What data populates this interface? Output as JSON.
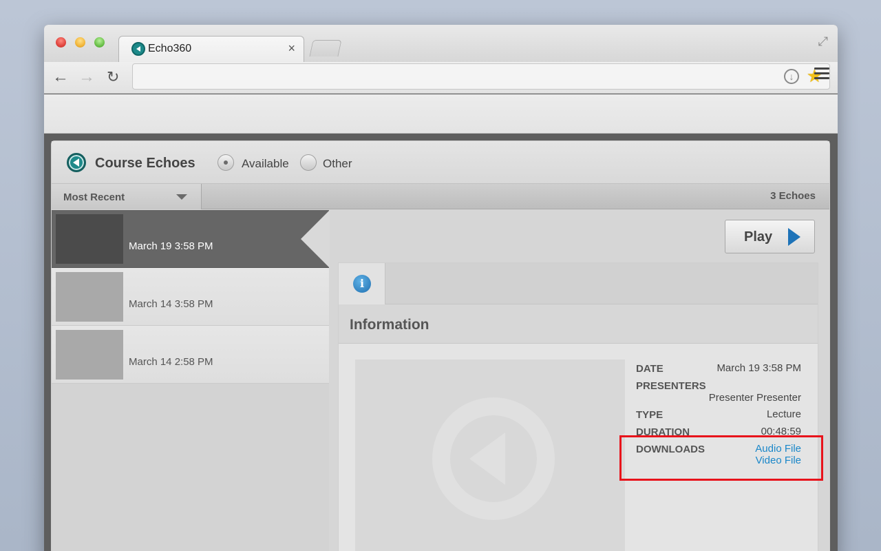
{
  "browser": {
    "tab_title": "Echo360",
    "tab_close": "×",
    "address": "",
    "back_glyph": "←",
    "forward_glyph": "→",
    "reload_glyph": "↻",
    "fullscreen_glyph": "⤢",
    "download_glyph": "↓",
    "star_glyph": "★"
  },
  "app": {
    "title": "Course Echoes",
    "filters": [
      {
        "label": "Available",
        "selected": true
      },
      {
        "label": "Other",
        "selected": false
      }
    ],
    "sort": {
      "selected": "Most Recent"
    },
    "echo_count": "3 Echoes",
    "echoes": [
      {
        "label": "March 19 3:58 PM",
        "selected": true
      },
      {
        "label": "March 14 3:58 PM",
        "selected": false
      },
      {
        "label": "March 14 2:58 PM",
        "selected": false
      }
    ],
    "play_label": "Play"
  },
  "info_panel": {
    "tab_icon": "i",
    "heading": "Information",
    "details": {
      "date_label": "DATE",
      "date_value": "March 19 3:58 PM",
      "presenters_label": "PRESENTERS",
      "presenters_value": "Presenter Presenter",
      "type_label": "TYPE",
      "type_value": "Lecture",
      "duration_label": "DURATION",
      "duration_value": "00:48:59",
      "downloads_label": "DOWNLOADS",
      "downloads": [
        "Audio File",
        "Video File"
      ]
    }
  },
  "colors": {
    "link": "#1a87c9",
    "highlight": "#e8131b",
    "brand": "#1e8a8a",
    "play_icon": "#1e73b8"
  }
}
